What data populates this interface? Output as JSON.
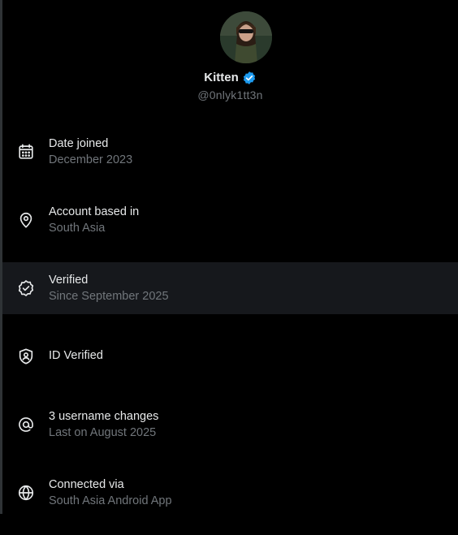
{
  "profile": {
    "display_name": "Kitten",
    "handle": "@0nlyk1tt3n",
    "verified": true,
    "badge_color": "#1d9bf0"
  },
  "info_items": [
    {
      "icon": "calendar-icon",
      "title": "Date joined",
      "subtitle": "December 2023"
    },
    {
      "icon": "location-pin-icon",
      "title": "Account based in",
      "subtitle": "South Asia"
    },
    {
      "icon": "verified-check-icon",
      "title": "Verified",
      "subtitle": "Since September 2025",
      "highlighted": true
    },
    {
      "icon": "id-shield-icon",
      "title": "ID Verified"
    },
    {
      "icon": "at-sign-icon",
      "title": "3 username changes",
      "subtitle": "Last on August 2025"
    },
    {
      "icon": "globe-icon",
      "title": "Connected via",
      "subtitle": "South Asia Android App"
    }
  ],
  "colors": {
    "background": "#000000",
    "text_primary": "#e7e9ea",
    "text_secondary": "#71767b",
    "highlight_row": "#16181c"
  }
}
